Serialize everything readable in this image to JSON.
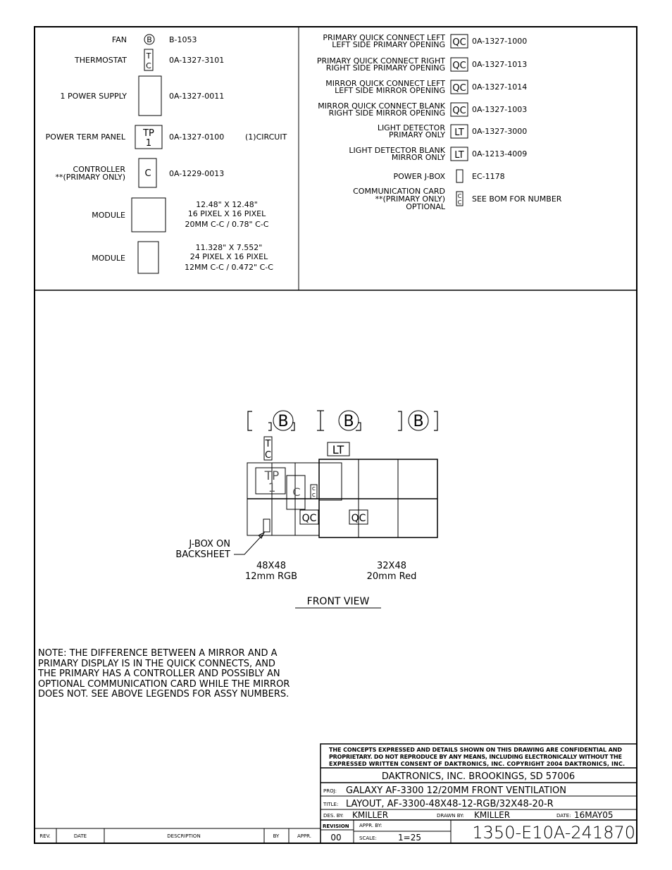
{
  "legend_left": {
    "fan": {
      "label": "FAN",
      "symbol": "B",
      "part": "B-1053"
    },
    "thermostat": {
      "label": "THERMOSTAT",
      "symbol_top": "T",
      "symbol_bottom": "C",
      "part": "0A-1327-3101"
    },
    "power_supply": {
      "label": "1 POWER SUPPLY",
      "part": "0A-1327-0011"
    },
    "power_term_panel": {
      "label": "POWER TERM PANEL",
      "symbol_top": "TP",
      "symbol_bottom": "1",
      "part": "0A-1327-0100",
      "note": "(1)CIRCUIT"
    },
    "controller": {
      "label": "CONTROLLER",
      "label2": "**(PRIMARY ONLY)",
      "symbol": "C",
      "part": "0A-1229-0013"
    },
    "module1": {
      "label": "MODULE",
      "line1": "12.48\" X 12.48\"",
      "line2": "16 PIXEL X 16 PIXEL",
      "line3": "20MM C-C / 0.78\" C-C"
    },
    "module2": {
      "label": "MODULE",
      "line1": "11.328\" X 7.552\"",
      "line2": "24 PIXEL X 16 PIXEL",
      "line3": "12MM C-C / 0.472\" C-C"
    }
  },
  "legend_right": [
    {
      "label1": "PRIMARY QUICK CONNECT LEFT",
      "label2": "LEFT SIDE PRIMARY OPENING",
      "symbol": "QC",
      "part": "0A-1327-1000"
    },
    {
      "label1": "PRIMARY QUICK CONNECT RIGHT",
      "label2": "RIGHT SIDE PRIMARY OPENING",
      "symbol": "QC",
      "part": "0A-1327-1013"
    },
    {
      "label1": "MIRROR QUICK CONNECT LEFT",
      "label2": "LEFT SIDE MIRROR OPENING",
      "symbol": "QC",
      "part": "0A-1327-1014"
    },
    {
      "label1": "MIRROR QUICK CONNECT BLANK",
      "label2": "RIGHT SIDE MIRROR OPENING",
      "symbol": "QC",
      "part": "0A-1327-1003"
    },
    {
      "label1": "LIGHT DETECTOR",
      "label2": "PRIMARY ONLY",
      "symbol": "LT",
      "part": "0A-1327-3000"
    },
    {
      "label1": "LIGHT DETECTOR BLANK",
      "label2": "MIRROR ONLY",
      "symbol": "LT",
      "part": "0A-1213-4009"
    },
    {
      "label1": "POWER J-BOX",
      "part": "EC-1178"
    },
    {
      "label1": "COMMUNICATION CARD",
      "label2": "**(PRIMARY ONLY)",
      "label3": "OPTIONAL",
      "symbol_top": "C",
      "symbol_bottom": "C",
      "part": "SEE BOM FOR NUMBER"
    }
  ],
  "front_view": {
    "fan_symbol": "B",
    "tc_top": "T",
    "tc_bottom": "C",
    "lt": "LT",
    "tp_top": "TP",
    "tp_bottom": "1",
    "controller": "C",
    "cc": "CC",
    "qc": "QC",
    "jbox_label1": "J-BOX ON",
    "jbox_label2": "BACKSHEET",
    "left_caption1": "48X48",
    "left_caption2": "12mm RGB",
    "right_caption1": "32X48",
    "right_caption2": "20mm Red",
    "title": "FRONT VIEW"
  },
  "note": [
    "NOTE:  THE DIFFERENCE BETWEEN A MIRROR AND A",
    "PRIMARY DISPLAY IS IN THE QUICK CONNECTS, AND",
    "THE PRIMARY HAS A CONTROLLER AND POSSIBLY AN",
    "OPTIONAL COMMUNICATION CARD WHILE THE MIRROR",
    "DOES NOT.  SEE ABOVE LEGENDS FOR ASSY NUMBERS."
  ],
  "title_block": {
    "notice": [
      "THE CONCEPTS  EXPRESSED  AND  DETAILS SHOWN ON THIS DRAWING ARE CONFIDENTIAL AND",
      "PROPRIETARY.  DO NOT REPRODUCE BY ANY MEANS, INCLUDING ELECTRONICALLY WITHOUT THE",
      "EXPRESSED WRITTEN CONSENT OF DAKTRONICS, INC.        COPYRIGHT 2004 DAKTRONICS, INC."
    ],
    "company": "DAKTRONICS, INC.   BROOKINGS, SD 57006",
    "proj_label": "PROJ:",
    "proj": "GALAXY AF-3300 12/20MM FRONT VENTILATION",
    "title_label": "TITLE:",
    "title": "LAYOUT, AF-3300-48X48-12-RGB/32X48-20-R",
    "des_label": "DES. BY:",
    "des": "KMILLER",
    "drawn_label": "DRAWN BY:",
    "drawn": "KMILLER",
    "date_label": "DATE:",
    "date": "16MAY05",
    "revision_label": "REVISION",
    "revision": "00",
    "appr_label": "APPR. BY:",
    "scale_label": "SCALE:",
    "scale": "1=25",
    "drawing_number": "1350-E10A-241870"
  },
  "revision_table": {
    "columns": [
      "REV.",
      "DATE",
      "DESCRIPTION",
      "BY",
      "APPR."
    ]
  }
}
